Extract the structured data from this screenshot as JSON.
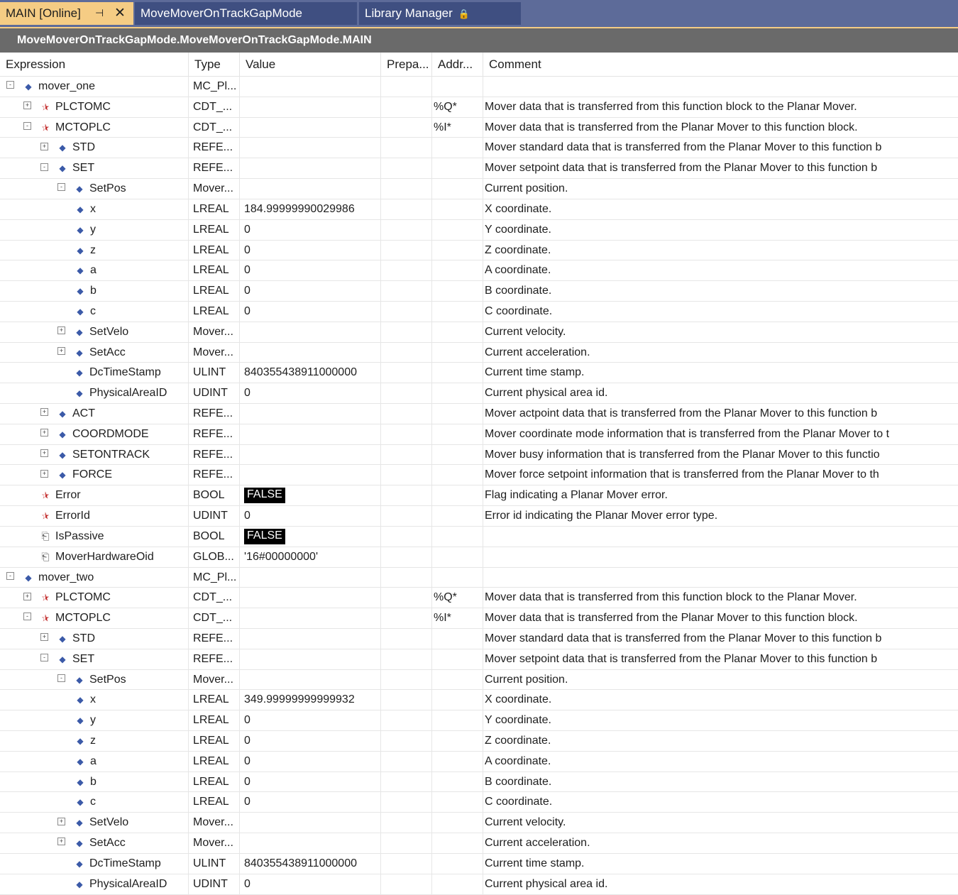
{
  "tabs": [
    {
      "label": "MAIN [Online]",
      "active": true
    },
    {
      "label": "MoveMoverOnTrackGapMode",
      "active": false
    },
    {
      "label": "Library Manager",
      "active": false
    }
  ],
  "path": "MoveMoverOnTrackGapMode.MoveMoverOnTrackGapMode.MAIN",
  "columns": {
    "expression": "Expression",
    "type": "Type",
    "value": "Value",
    "prepared": "Prepa...",
    "address": "Addr...",
    "comment": "Comment"
  },
  "rows": [
    {
      "level": 0,
      "toggle": "-",
      "icon": "var-icon",
      "name": "mover_one",
      "type": "MC_Pl...",
      "value": "",
      "addr": "",
      "comment": ""
    },
    {
      "level": 1,
      "toggle": "+",
      "icon": "io-output-icon",
      "name": "PLCTOMC",
      "type": "CDT_...",
      "value": "",
      "addr": "%Q*",
      "comment": "Mover data that is transferred from this function block to the Planar Mover."
    },
    {
      "level": 1,
      "toggle": "-",
      "icon": "io-input-icon",
      "name": "MCTOPLC",
      "type": "CDT_...",
      "value": "",
      "addr": "%I*",
      "comment": "Mover data that is transferred from the Planar Mover to this function block."
    },
    {
      "level": 2,
      "toggle": "+",
      "icon": "var-icon",
      "name": "STD",
      "type": "REFE...",
      "value": "",
      "addr": "",
      "comment": "Mover standard data that is transferred from the Planar Mover to this function b"
    },
    {
      "level": 2,
      "toggle": "-",
      "icon": "var-icon",
      "name": "SET",
      "type": "REFE...",
      "value": "",
      "addr": "",
      "comment": "Mover setpoint data that is transferred from the Planar Mover to this function b"
    },
    {
      "level": 3,
      "toggle": "-",
      "icon": "var-icon",
      "name": "SetPos",
      "type": "Mover...",
      "value": "",
      "addr": "",
      "comment": "Current position."
    },
    {
      "level": 4,
      "toggle": "",
      "icon": "var-icon",
      "name": "x",
      "type": "LREAL",
      "value": "184.99999990029986",
      "addr": "",
      "comment": "X coordinate."
    },
    {
      "level": 4,
      "toggle": "",
      "icon": "var-icon",
      "name": "y",
      "type": "LREAL",
      "value": "0",
      "addr": "",
      "comment": "Y coordinate."
    },
    {
      "level": 4,
      "toggle": "",
      "icon": "var-icon",
      "name": "z",
      "type": "LREAL",
      "value": "0",
      "addr": "",
      "comment": "Z coordinate."
    },
    {
      "level": 4,
      "toggle": "",
      "icon": "var-icon",
      "name": "a",
      "type": "LREAL",
      "value": "0",
      "addr": "",
      "comment": "A coordinate."
    },
    {
      "level": 4,
      "toggle": "",
      "icon": "var-icon",
      "name": "b",
      "type": "LREAL",
      "value": "0",
      "addr": "",
      "comment": "B coordinate."
    },
    {
      "level": 4,
      "toggle": "",
      "icon": "var-icon",
      "name": "c",
      "type": "LREAL",
      "value": "0",
      "addr": "",
      "comment": "C coordinate."
    },
    {
      "level": 3,
      "toggle": "+",
      "icon": "var-icon",
      "name": "SetVelo",
      "type": "Mover...",
      "value": "",
      "addr": "",
      "comment": "Current velocity."
    },
    {
      "level": 3,
      "toggle": "+",
      "icon": "var-icon",
      "name": "SetAcc",
      "type": "Mover...",
      "value": "",
      "addr": "",
      "comment": "Current acceleration."
    },
    {
      "level": 3,
      "toggle": "none",
      "icon": "var-icon",
      "name": "DcTimeStamp",
      "type": "ULINT",
      "value": "840355438911000000",
      "addr": "",
      "comment": "Current time stamp."
    },
    {
      "level": 3,
      "toggle": "none",
      "icon": "var-icon",
      "name": "PhysicalAreaID",
      "type": "UDINT",
      "value": "0",
      "addr": "",
      "comment": "Current physical area id."
    },
    {
      "level": 2,
      "toggle": "+",
      "icon": "var-icon",
      "name": "ACT",
      "type": "REFE...",
      "value": "",
      "addr": "",
      "comment": "Mover actpoint data that is transferred from the Planar Mover to this function b"
    },
    {
      "level": 2,
      "toggle": "+",
      "icon": "var-icon",
      "name": "COORDMODE",
      "type": "REFE...",
      "value": "",
      "addr": "",
      "comment": "Mover coordinate mode information that is transferred from the Planar Mover to t"
    },
    {
      "level": 2,
      "toggle": "+",
      "icon": "var-icon",
      "name": "SETONTRACK",
      "type": "REFE...",
      "value": "",
      "addr": "",
      "comment": "Mover busy information that is transferred from the Planar Mover to this functio"
    },
    {
      "level": 2,
      "toggle": "+",
      "icon": "var-icon",
      "name": "FORCE",
      "type": "REFE...",
      "value": "",
      "addr": "",
      "comment": "Mover force setpoint information that is transferred from the Planar Mover to th"
    },
    {
      "level": 1,
      "toggle": "none",
      "icon": "output-var-icon",
      "name": "Error",
      "type": "BOOL",
      "value": "FALSE",
      "badge": true,
      "addr": "",
      "comment": "Flag indicating a Planar Mover error."
    },
    {
      "level": 1,
      "toggle": "none",
      "icon": "output-var-icon",
      "name": "ErrorId",
      "type": "UDINT",
      "value": "0",
      "addr": "",
      "comment": "Error id indicating the Planar Mover error type."
    },
    {
      "level": 1,
      "toggle": "none",
      "icon": "property-icon",
      "name": "IsPassive",
      "type": "BOOL",
      "value": "FALSE",
      "badge": true,
      "addr": "",
      "comment": ""
    },
    {
      "level": 1,
      "toggle": "none",
      "icon": "property-icon",
      "name": "MoverHardwareOid",
      "type": "GLOB...",
      "value": "'16#00000000'",
      "addr": "",
      "comment": ""
    },
    {
      "level": 0,
      "toggle": "-",
      "icon": "var-icon",
      "name": "mover_two",
      "type": "MC_Pl...",
      "value": "",
      "addr": "",
      "comment": ""
    },
    {
      "level": 1,
      "toggle": "+",
      "icon": "io-output-icon",
      "name": "PLCTOMC",
      "type": "CDT_...",
      "value": "",
      "addr": "%Q*",
      "comment": "Mover data that is transferred from this function block to the Planar Mover."
    },
    {
      "level": 1,
      "toggle": "-",
      "icon": "io-input-icon",
      "name": "MCTOPLC",
      "type": "CDT_...",
      "value": "",
      "addr": "%I*",
      "comment": "Mover data that is transferred from the Planar Mover to this function block."
    },
    {
      "level": 2,
      "toggle": "+",
      "icon": "var-icon",
      "name": "STD",
      "type": "REFE...",
      "value": "",
      "addr": "",
      "comment": "Mover standard data that is transferred from the Planar Mover to this function b"
    },
    {
      "level": 2,
      "toggle": "-",
      "icon": "var-icon",
      "name": "SET",
      "type": "REFE...",
      "value": "",
      "addr": "",
      "comment": "Mover setpoint data that is transferred from the Planar Mover to this function b"
    },
    {
      "level": 3,
      "toggle": "-",
      "icon": "var-icon",
      "name": "SetPos",
      "type": "Mover...",
      "value": "",
      "addr": "",
      "comment": "Current position."
    },
    {
      "level": 4,
      "toggle": "",
      "icon": "var-icon",
      "name": "x",
      "type": "LREAL",
      "value": "349.99999999999932",
      "addr": "",
      "comment": "X coordinate."
    },
    {
      "level": 4,
      "toggle": "",
      "icon": "var-icon",
      "name": "y",
      "type": "LREAL",
      "value": "0",
      "addr": "",
      "comment": "Y coordinate."
    },
    {
      "level": 4,
      "toggle": "",
      "icon": "var-icon",
      "name": "z",
      "type": "LREAL",
      "value": "0",
      "addr": "",
      "comment": "Z coordinate."
    },
    {
      "level": 4,
      "toggle": "",
      "icon": "var-icon",
      "name": "a",
      "type": "LREAL",
      "value": "0",
      "addr": "",
      "comment": "A coordinate."
    },
    {
      "level": 4,
      "toggle": "",
      "icon": "var-icon",
      "name": "b",
      "type": "LREAL",
      "value": "0",
      "addr": "",
      "comment": "B coordinate."
    },
    {
      "level": 4,
      "toggle": "",
      "icon": "var-icon",
      "name": "c",
      "type": "LREAL",
      "value": "0",
      "addr": "",
      "comment": "C coordinate."
    },
    {
      "level": 3,
      "toggle": "+",
      "icon": "var-icon",
      "name": "SetVelo",
      "type": "Mover...",
      "value": "",
      "addr": "",
      "comment": "Current velocity."
    },
    {
      "level": 3,
      "toggle": "+",
      "icon": "var-icon",
      "name": "SetAcc",
      "type": "Mover...",
      "value": "",
      "addr": "",
      "comment": "Current acceleration."
    },
    {
      "level": 3,
      "toggle": "none",
      "icon": "var-icon",
      "name": "DcTimeStamp",
      "type": "ULINT",
      "value": "840355438911000000",
      "addr": "",
      "comment": "Current time stamp."
    },
    {
      "level": 3,
      "toggle": "none",
      "icon": "var-icon",
      "name": "PhysicalAreaID",
      "type": "UDINT",
      "value": "0",
      "addr": "",
      "comment": "Current physical area id."
    }
  ]
}
